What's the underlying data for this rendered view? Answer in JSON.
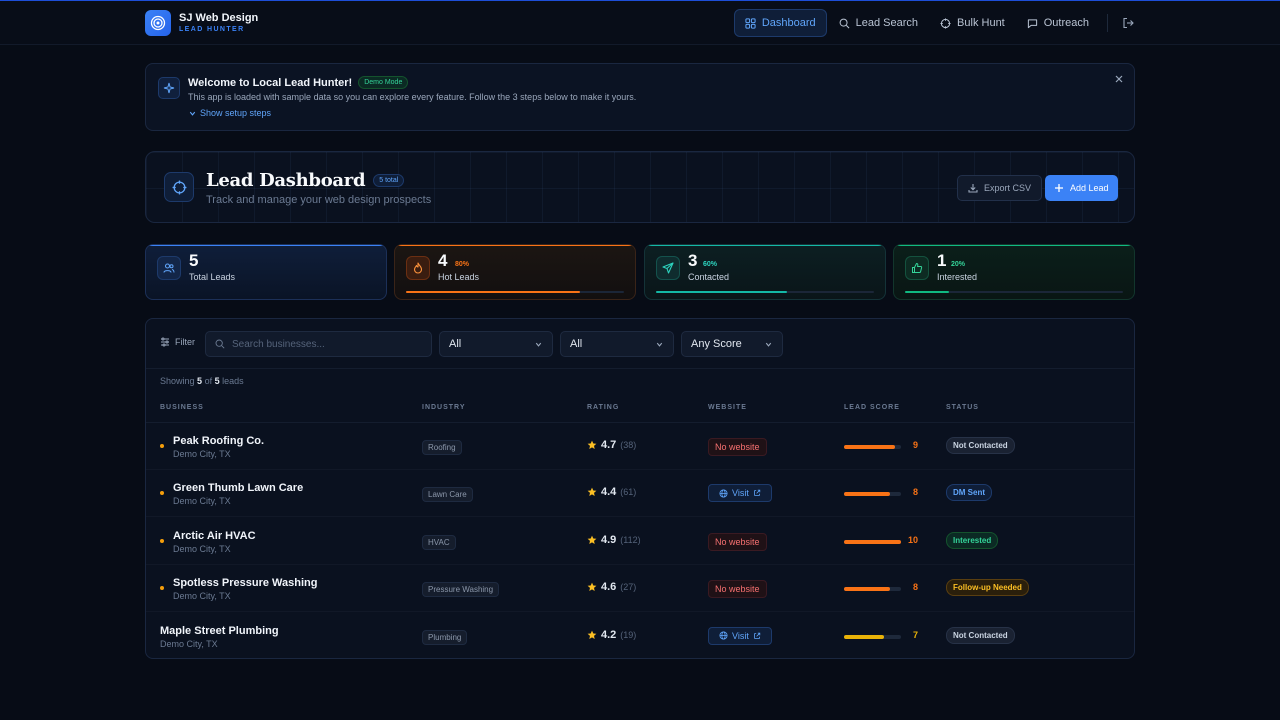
{
  "brand": {
    "name": "SJ Web Design",
    "subtitle": "LEAD HUNTER"
  },
  "nav": {
    "items": [
      {
        "label": "Dashboard",
        "icon": "grid-icon",
        "active": true
      },
      {
        "label": "Lead Search",
        "icon": "search-icon"
      },
      {
        "label": "Bulk Hunt",
        "icon": "crosshair-icon"
      },
      {
        "label": "Outreach",
        "icon": "message-icon"
      }
    ]
  },
  "welcome": {
    "title": "Welcome to Local Lead Hunter!",
    "badge": "Demo Mode",
    "description": "This app is loaded with sample data so you can explore every feature. Follow the 3 steps below to make it yours.",
    "setup_link": "Show setup steps"
  },
  "dashboard": {
    "title": "Lead Dashboard",
    "count_badge": "5 total",
    "subtitle": "Track and manage your web design prospects",
    "export_label": "Export CSV",
    "add_label": "Add Lead"
  },
  "stats": [
    {
      "value": "5",
      "label": "Total Leads",
      "pct": "",
      "progress": 0,
      "color": "#3b82f6"
    },
    {
      "value": "4",
      "label": "Hot Leads",
      "pct": "80%",
      "progress": 0.8,
      "color": "#f97316"
    },
    {
      "value": "3",
      "label": "Contacted",
      "pct": "60%",
      "progress": 0.6,
      "color": "#14b8a6"
    },
    {
      "value": "1",
      "label": "Interested",
      "pct": "20%",
      "progress": 0.2,
      "color": "#10b981"
    }
  ],
  "filters": {
    "label": "Filter",
    "search_placeholder": "Search businesses...",
    "industry": "All",
    "status": "All",
    "score": "Any Score"
  },
  "showing": {
    "prefix": "Showing",
    "shown": "5",
    "of": "of",
    "total": "5",
    "suffix": "leads"
  },
  "table": {
    "headers": [
      "BUSINESS",
      "INDUSTRY",
      "RATING",
      "WEBSITE",
      "LEAD SCORE",
      "STATUS"
    ],
    "rows": [
      {
        "name": "Peak Roofing Co.",
        "location": "Demo City, TX",
        "hot": true,
        "industry": "Roofing",
        "rating": "4.7",
        "reviews": "(38)",
        "website": "No website",
        "has_website": false,
        "score": 9,
        "score_color": "#f97316",
        "status": "Not Contacted",
        "status_type": "neutral"
      },
      {
        "name": "Green Thumb Lawn Care",
        "location": "Demo City, TX",
        "hot": true,
        "industry": "Lawn Care",
        "rating": "4.4",
        "reviews": "(61)",
        "website": "Visit",
        "has_website": true,
        "score": 8,
        "score_color": "#f97316",
        "status": "DM Sent",
        "status_type": "blue"
      },
      {
        "name": "Arctic Air HVAC",
        "location": "Demo City, TX",
        "hot": true,
        "industry": "HVAC",
        "rating": "4.9",
        "reviews": "(112)",
        "website": "No website",
        "has_website": false,
        "score": 10,
        "score_color": "#f97316",
        "status": "Interested",
        "status_type": "green"
      },
      {
        "name": "Spotless Pressure Washing",
        "location": "Demo City, TX",
        "hot": true,
        "industry": "Pressure Washing",
        "rating": "4.6",
        "reviews": "(27)",
        "website": "No website",
        "has_website": false,
        "score": 8,
        "score_color": "#f97316",
        "status": "Follow-up Needed",
        "status_type": "amber"
      },
      {
        "name": "Maple Street Plumbing",
        "location": "Demo City, TX",
        "hot": false,
        "industry": "Plumbing",
        "rating": "4.2",
        "reviews": "(19)",
        "website": "Visit",
        "has_website": true,
        "score": 7,
        "score_color": "#eab308",
        "status": "Not Contacted",
        "status_type": "neutral"
      }
    ]
  }
}
